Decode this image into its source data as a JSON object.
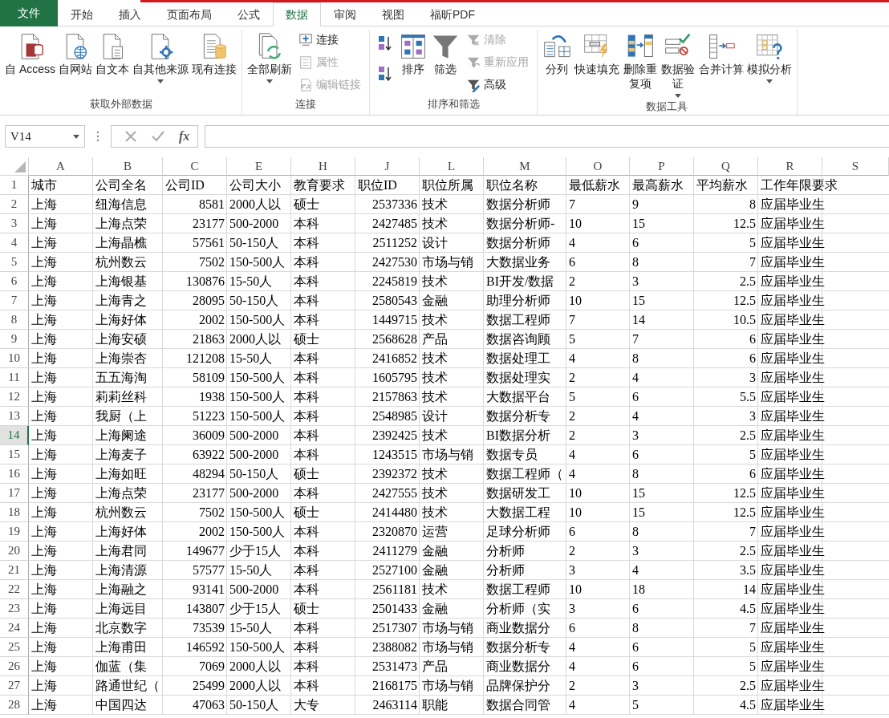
{
  "tabs": [
    {
      "label": "文件",
      "kind": "file",
      "selected": false
    },
    {
      "label": "开始",
      "kind": "tab",
      "selected": false
    },
    {
      "label": "插入",
      "kind": "tab",
      "selected": false
    },
    {
      "label": "页面布局",
      "kind": "tab",
      "selected": false
    },
    {
      "label": "公式",
      "kind": "tab",
      "selected": false
    },
    {
      "label": "数据",
      "kind": "tab",
      "selected": true
    },
    {
      "label": "审阅",
      "kind": "tab",
      "selected": false
    },
    {
      "label": "视图",
      "kind": "tab",
      "selected": false
    },
    {
      "label": "福昕PDF",
      "kind": "tab",
      "selected": false
    }
  ],
  "ribbon_groups": [
    {
      "label": "获取外部数据",
      "buttons": [
        {
          "kind": "large",
          "label": "自 Access",
          "dropdown": false
        },
        {
          "kind": "large",
          "label": "自网站",
          "dropdown": false
        },
        {
          "kind": "large",
          "label": "自文本",
          "dropdown": false
        },
        {
          "kind": "large",
          "label": "自其他来源",
          "dropdown": true
        },
        {
          "kind": "large",
          "label": "现有连接",
          "dropdown": false
        }
      ]
    },
    {
      "label": "连接",
      "buttons": [
        {
          "kind": "large",
          "label": "全部刷新",
          "dropdown": true
        },
        {
          "kind": "stack",
          "items": [
            {
              "label": "连接",
              "disabled": false
            },
            {
              "label": "属性",
              "disabled": true
            },
            {
              "label": "编辑链接",
              "disabled": true
            }
          ]
        }
      ]
    },
    {
      "label": "排序和筛选",
      "buttons": [
        {
          "kind": "sort-pair"
        },
        {
          "kind": "large",
          "label": "排序",
          "dropdown": false
        },
        {
          "kind": "large",
          "label": "筛选",
          "dropdown": false
        },
        {
          "kind": "stack",
          "items": [
            {
              "label": "清除",
              "disabled": true
            },
            {
              "label": "重新应用",
              "disabled": true
            },
            {
              "label": "高级",
              "disabled": false
            }
          ]
        }
      ]
    },
    {
      "label": "数据工具",
      "buttons": [
        {
          "kind": "large",
          "label": "分列",
          "dropdown": false
        },
        {
          "kind": "large",
          "label": "快速填充",
          "dropdown": false
        },
        {
          "kind": "narrow",
          "label": "删除重复项",
          "dropdown": false
        },
        {
          "kind": "narrow",
          "label": "数据验证",
          "dropdown": true
        },
        {
          "kind": "large",
          "label": "合并计算",
          "dropdown": false
        },
        {
          "kind": "large",
          "label": "模拟分析",
          "dropdown": true
        }
      ]
    }
  ],
  "formula_bar": {
    "name_box": "V14",
    "function_label": "fx"
  },
  "sheet": {
    "columns": [
      {
        "letter": "A",
        "kind": "text"
      },
      {
        "letter": "B",
        "kind": "text"
      },
      {
        "letter": "C",
        "kind": "number"
      },
      {
        "letter": "E",
        "kind": "text"
      },
      {
        "letter": "H",
        "kind": "text"
      },
      {
        "letter": "J",
        "kind": "number"
      },
      {
        "letter": "L",
        "kind": "text"
      },
      {
        "letter": "M",
        "kind": "text"
      },
      {
        "letter": "O",
        "kind": "text"
      },
      {
        "letter": "P",
        "kind": "text"
      },
      {
        "letter": "Q",
        "kind": "number"
      },
      {
        "letter": "R",
        "kind": "text"
      },
      {
        "letter": "S"
      }
    ],
    "rows": [
      {
        "number": "1",
        "kind": "labels",
        "selected": false,
        "cells": [
          "城市",
          "公司全名",
          "公司ID",
          "公司大小",
          "教育要求",
          "职位ID",
          "职位所属",
          "职位名称",
          "最低薪水",
          "最高薪水",
          "平均薪水",
          "工作年限要求"
        ]
      },
      {
        "number": "2",
        "kind": "data",
        "selected": false,
        "cells": [
          "上海",
          "纽海信息",
          "8581",
          "2000人以",
          "硕士",
          "2537336",
          "技术",
          "数据分析师",
          "7",
          "9",
          "8",
          "应届毕业生"
        ]
      },
      {
        "number": "3",
        "kind": "data",
        "selected": false,
        "cells": [
          "上海",
          "上海点荣",
          "23177",
          "500-2000",
          "本科",
          "2427485",
          "技术",
          "数据分析师-",
          "10",
          "15",
          "12.5",
          "应届毕业生"
        ]
      },
      {
        "number": "4",
        "kind": "data",
        "selected": false,
        "cells": [
          "上海",
          "上海晶樵",
          "57561",
          "50-150人",
          "本科",
          "2511252",
          "设计",
          "数据分析师",
          "4",
          "6",
          "5",
          "应届毕业生"
        ]
      },
      {
        "number": "5",
        "kind": "data",
        "selected": false,
        "cells": [
          "上海",
          "杭州数云",
          "7502",
          "150-500人",
          "本科",
          "2427530",
          "市场与销",
          "大数据业务",
          "6",
          "8",
          "7",
          "应届毕业生"
        ]
      },
      {
        "number": "6",
        "kind": "data",
        "selected": false,
        "cells": [
          "上海",
          "上海银基",
          "130876",
          "15-50人",
          "本科",
          "2245819",
          "技术",
          "BI开发/数据",
          "2",
          "3",
          "2.5",
          "应届毕业生"
        ]
      },
      {
        "number": "7",
        "kind": "data",
        "selected": false,
        "cells": [
          "上海",
          "上海青之",
          "28095",
          "50-150人",
          "本科",
          "2580543",
          "金融",
          "助理分析师",
          "10",
          "15",
          "12.5",
          "应届毕业生"
        ]
      },
      {
        "number": "8",
        "kind": "data",
        "selected": false,
        "cells": [
          "上海",
          "上海好体",
          "2002",
          "150-500人",
          "本科",
          "1449715",
          "技术",
          "数据工程师",
          "7",
          "14",
          "10.5",
          "应届毕业生"
        ]
      },
      {
        "number": "9",
        "kind": "data",
        "selected": false,
        "cells": [
          "上海",
          "上海安硕",
          "21863",
          "2000人以",
          "硕士",
          "2568628",
          "产品",
          "数据咨询顾",
          "5",
          "7",
          "6",
          "应届毕业生"
        ]
      },
      {
        "number": "10",
        "kind": "data",
        "selected": false,
        "cells": [
          "上海",
          "上海崇杏",
          "121208",
          "15-50人",
          "本科",
          "2416852",
          "技术",
          "数据处理工",
          "4",
          "8",
          "6",
          "应届毕业生"
        ]
      },
      {
        "number": "11",
        "kind": "data",
        "selected": false,
        "cells": [
          "上海",
          "五五海淘",
          "58109",
          "150-500人",
          "本科",
          "1605795",
          "技术",
          "数据处理实",
          "2",
          "4",
          "3",
          "应届毕业生"
        ]
      },
      {
        "number": "12",
        "kind": "data",
        "selected": false,
        "cells": [
          "上海",
          "莉莉丝科",
          "1938",
          "150-500人",
          "本科",
          "2157863",
          "技术",
          "大数据平台",
          "5",
          "6",
          "5.5",
          "应届毕业生"
        ]
      },
      {
        "number": "13",
        "kind": "data",
        "selected": false,
        "cells": [
          "上海",
          "我厨（上",
          "51223",
          "150-500人",
          "本科",
          "2548985",
          "设计",
          "数据分析专",
          "2",
          "4",
          "3",
          "应届毕业生"
        ]
      },
      {
        "number": "14",
        "kind": "data",
        "selected": true,
        "cells": [
          "上海",
          "上海阑途",
          "36009",
          "500-2000",
          "本科",
          "2392425",
          "技术",
          "BI数据分析",
          "2",
          "3",
          "2.5",
          "应届毕业生"
        ]
      },
      {
        "number": "15",
        "kind": "data",
        "selected": false,
        "cells": [
          "上海",
          "上海麦子",
          "63922",
          "500-2000",
          "本科",
          "1243515",
          "市场与销",
          "数据专员",
          "4",
          "6",
          "5",
          "应届毕业生"
        ]
      },
      {
        "number": "16",
        "kind": "data",
        "selected": false,
        "cells": [
          "上海",
          "上海如旺",
          "48294",
          "50-150人",
          "硕士",
          "2392372",
          "技术",
          "数据工程师（",
          "4",
          "8",
          "6",
          "应届毕业生"
        ]
      },
      {
        "number": "17",
        "kind": "data",
        "selected": false,
        "cells": [
          "上海",
          "上海点荣",
          "23177",
          "500-2000",
          "本科",
          "2427555",
          "技术",
          "数据研发工",
          "10",
          "15",
          "12.5",
          "应届毕业生"
        ]
      },
      {
        "number": "18",
        "kind": "data",
        "selected": false,
        "cells": [
          "上海",
          "杭州数云",
          "7502",
          "150-500人",
          "硕士",
          "2414480",
          "技术",
          "大数据工程",
          "10",
          "15",
          "12.5",
          "应届毕业生"
        ]
      },
      {
        "number": "19",
        "kind": "data",
        "selected": false,
        "cells": [
          "上海",
          "上海好体",
          "2002",
          "150-500人",
          "本科",
          "2320870",
          "运营",
          "足球分析师",
          "6",
          "8",
          "7",
          "应届毕业生"
        ]
      },
      {
        "number": "20",
        "kind": "data",
        "selected": false,
        "cells": [
          "上海",
          "上海君同",
          "149677",
          "少于15人",
          "本科",
          "2411279",
          "金融",
          "分析师",
          "2",
          "3",
          "2.5",
          "应届毕业生"
        ]
      },
      {
        "number": "21",
        "kind": "data",
        "selected": false,
        "cells": [
          "上海",
          "上海清源",
          "57577",
          "15-50人",
          "本科",
          "2527100",
          "金融",
          "分析师",
          "3",
          "4",
          "3.5",
          "应届毕业生"
        ]
      },
      {
        "number": "22",
        "kind": "data",
        "selected": false,
        "cells": [
          "上海",
          "上海融之",
          "93141",
          "500-2000",
          "本科",
          "2561181",
          "技术",
          "数据工程师",
          "10",
          "18",
          "14",
          "应届毕业生"
        ]
      },
      {
        "number": "23",
        "kind": "data",
        "selected": false,
        "cells": [
          "上海",
          "上海远目",
          "143807",
          "少于15人",
          "硕士",
          "2501433",
          "金融",
          "分析师（实",
          "3",
          "6",
          "4.5",
          "应届毕业生"
        ]
      },
      {
        "number": "24",
        "kind": "data",
        "selected": false,
        "cells": [
          "上海",
          "北京数字",
          "73539",
          "15-50人",
          "本科",
          "2517307",
          "市场与销",
          "商业数据分",
          "6",
          "8",
          "7",
          "应届毕业生"
        ]
      },
      {
        "number": "25",
        "kind": "data",
        "selected": false,
        "cells": [
          "上海",
          "上海甫田",
          "146592",
          "150-500人",
          "本科",
          "2388082",
          "市场与销",
          "数据分析专",
          "4",
          "6",
          "5",
          "应届毕业生"
        ]
      },
      {
        "number": "26",
        "kind": "data",
        "selected": false,
        "cells": [
          "上海",
          "伽蓝（集",
          "7069",
          "2000人以",
          "本科",
          "2531473",
          "产品",
          "商业数据分",
          "4",
          "6",
          "5",
          "应届毕业生"
        ]
      },
      {
        "number": "27",
        "kind": "data",
        "selected": false,
        "cells": [
          "上海",
          "路通世纪（",
          "25499",
          "2000人以",
          "本科",
          "2168175",
          "市场与销",
          "品牌保护分",
          "2",
          "3",
          "2.5",
          "应届毕业生"
        ]
      },
      {
        "number": "28",
        "kind": "data",
        "selected": false,
        "cells": [
          "上海",
          "中国四达",
          "47063",
          "50-150人",
          "大专",
          "2463114",
          "职能",
          "数据合同管",
          "4",
          "5",
          "4.5",
          "应届毕业生"
        ]
      }
    ]
  }
}
